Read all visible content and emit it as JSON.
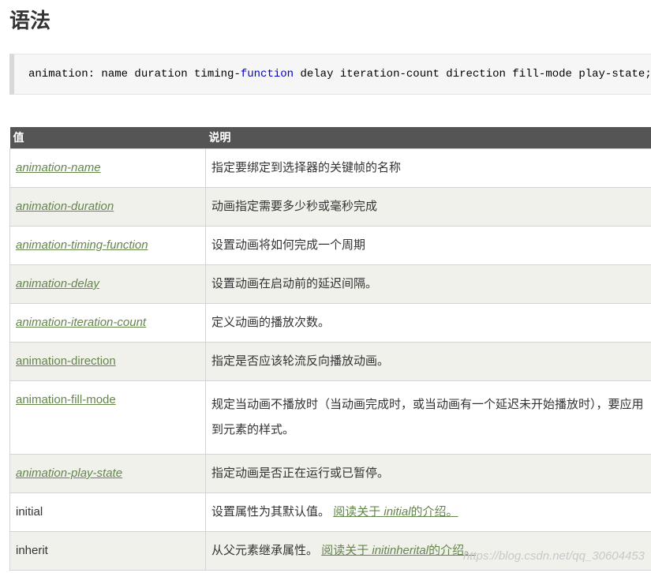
{
  "heading": "语法",
  "syntax": {
    "before": "animation: name duration timing-",
    "keyword": "function",
    "after": " delay iteration-count direction fill-mode play-state;"
  },
  "table": {
    "headers": [
      "值",
      "说明"
    ],
    "rows": [
      {
        "value": "animation-name",
        "desc": "指定要绑定到选择器的关键帧的名称"
      },
      {
        "value": "animation-duration",
        "desc": "动画指定需要多少秒或毫秒完成"
      },
      {
        "value": "animation-timing-function",
        "desc": "设置动画将如何完成一个周期"
      },
      {
        "value": "animation-delay",
        "desc": "设置动画在启动前的延迟间隔。"
      },
      {
        "value": "animation-iteration-count",
        "desc": "定义动画的播放次数。"
      },
      {
        "value": "animation-direction",
        "desc": "指定是否应该轮流反向播放动画。"
      },
      {
        "value": "animation-fill-mode",
        "desc": "规定当动画不播放时（当动画完成时，或当动画有一个延迟未开始播放时），要应用到元素的样式。"
      },
      {
        "value": "animation-play-state",
        "desc": "指定动画是否正在运行或已暂停。"
      },
      {
        "value": "initial",
        "desc": "设置属性为其默认值。",
        "link_pre": "阅读关于 ",
        "link_em": "initial",
        "link_post": "的介绍。"
      },
      {
        "value": "inherit",
        "desc": "从父元素继承属性。",
        "link_pre": "阅读关于 ",
        "link_em": "initinherital",
        "link_post": "的介绍。"
      }
    ]
  },
  "watermark": "https://blog.csdn.net/qq_30604453"
}
